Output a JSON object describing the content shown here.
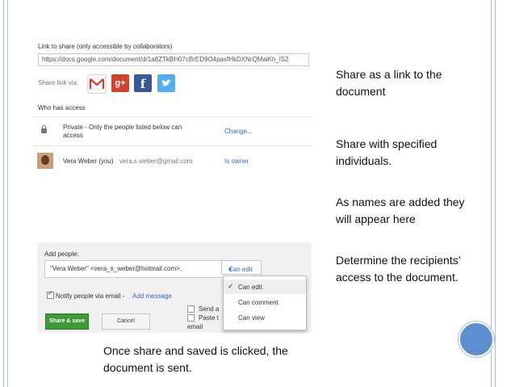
{
  "share_panel": {
    "link_label": "Link to share (only accessible by collaborators)",
    "url": "https://docs.google.com/document/d/1a8ZTkBH07cBrED9O4pasfHkDXNrQMaiKh_lS2",
    "share_via_label": "Share link via:",
    "who_has_access_label": "Who has access",
    "private_text_line1": "Private - Only the people listed below can",
    "private_text_line2": "access",
    "change_link": "Change...",
    "owner_name": "Vera Weber (you)",
    "owner_email": "vera.s.weber@gmail.com",
    "owner_role": "Is owner"
  },
  "add_panel": {
    "add_people_label": "Add people:",
    "recipient_value": "\"Vera Weber\" <vera_s_weber@hotmail.com>,",
    "permission": "Can edit",
    "notify_label": "Notify people via email -",
    "add_message_link": "Add message",
    "send_copy_label": "Send a",
    "paste_label": "Paste t",
    "email_label": "email",
    "save_button": "Share & save",
    "cancel_button": "Cancel",
    "menu_items": [
      "Can edit",
      "Can comment",
      "Can view"
    ]
  },
  "notes": {
    "n1": "Share as a link to the document",
    "n2": "Share with specified individuals.",
    "n3": "As names are added they will appear here",
    "n4": "Determine the recipients’ access to the document.",
    "n5": "Once share and saved is clicked, the document is sent."
  },
  "colors": {
    "accent": "#3366cc",
    "save": "#3d9a36",
    "circle": "#5b8fd0"
  }
}
